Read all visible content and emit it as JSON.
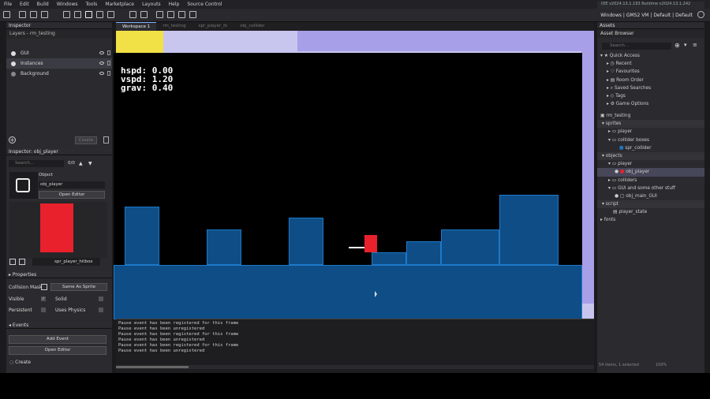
{
  "menu": [
    "File",
    "Edit",
    "Build",
    "Windows",
    "Tools",
    "Marketplace",
    "Layouts",
    "Help",
    "Source Control"
  ],
  "ide_version": "IDE v2024.13.1.193  Runtime v2024.13.1.242",
  "target": "Windows | GMS2 VM | Default | Default",
  "inspector": {
    "title": "Inspector",
    "path": "Layers - rm_testing",
    "layers": [
      "GUI",
      "Instances",
      "Background"
    ],
    "search_placeholder": "Search...",
    "counter": "0/0",
    "create_label": "Create",
    "obj_title": "Inspector: obj_player",
    "object_label": "Object",
    "object_name": "obj_player",
    "open_editor": "Open Editor",
    "mask_name": "spr_player_hitbox",
    "properties_label": "Properties",
    "collision_mask_label": "Collision Mask",
    "same_as_sprite": "Same As Sprite",
    "visible_label": "Visible",
    "solid_label": "Solid",
    "persistent_label": "Persistent",
    "uses_physics_label": "Uses Physics",
    "events_label": "Events",
    "add_event": "Add Event",
    "open_editor2": "Open Editor",
    "create_event": "Create"
  },
  "workspace": {
    "tabs": [
      "Workspace 1",
      "rm_testing",
      "spr_player_fx",
      "obj_collider"
    ],
    "hud": [
      "hspd: 0.00",
      "vspd: 1.20",
      "grav: 0.40"
    ]
  },
  "console": [
    "Pause event has been registered for this frame",
    "Pause event has been unregistered",
    "Pause event has been registered for this frame",
    "Pause event has been unregistered",
    "Pause event has been registered for this frame",
    "Pause event has been unregistered"
  ],
  "assets": {
    "title": "Assets",
    "browser": "Asset Browser",
    "search_placeholder": "Search...",
    "quick_access": "Quick Access",
    "quick_items": [
      "Recent",
      "Favourites",
      "Room Order",
      "Saved Searches",
      "Tags",
      "Game Options"
    ],
    "project": "rm_testing",
    "tree": [
      {
        "label": "sprites",
        "indent": 0,
        "hdr": true
      },
      {
        "label": "player",
        "indent": 1
      },
      {
        "label": "collider boxes",
        "indent": 1
      },
      {
        "label": "spr_collider",
        "indent": 2
      },
      {
        "label": "objects",
        "indent": 0,
        "hdr": true
      },
      {
        "label": "player",
        "indent": 1
      },
      {
        "label": "obj_player",
        "indent": 2,
        "sel": true
      },
      {
        "label": "colliders",
        "indent": 1
      },
      {
        "label": "GUI and some other stuff",
        "indent": 1
      },
      {
        "label": "obj_main_GUI",
        "indent": 2
      },
      {
        "label": "script",
        "indent": 0,
        "hdr": true
      },
      {
        "label": "player_state",
        "indent": 1
      },
      {
        "label": "fonts",
        "indent": 0
      }
    ],
    "footer": "54 items, 1 selected",
    "zoom": "100%"
  },
  "colors": {
    "player": "#e8212d",
    "block": "#0e4d86",
    "block_border": "#1d79c9"
  }
}
